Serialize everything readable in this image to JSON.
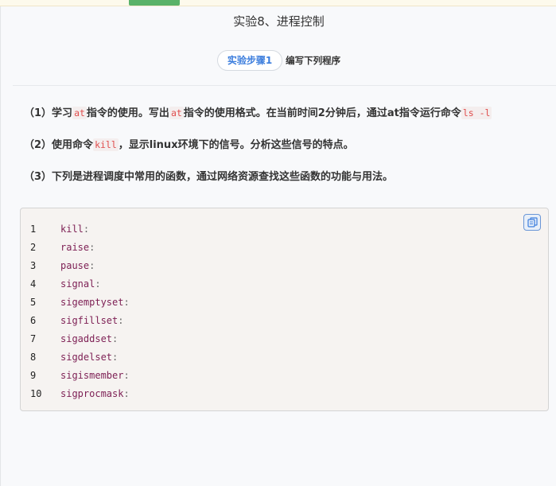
{
  "page": {
    "title": "实验8、进程控制",
    "step_pill": "实验步骤1",
    "step_desc": "编写下列程序"
  },
  "questions": {
    "q1": {
      "num": "（1）",
      "text_a": "学习",
      "code_a": "at",
      "text_b": "指令的使用。写出",
      "code_b": "at",
      "text_c": "指令的使用格式。在当前时间2分钟后，通过at指令运行命令",
      "code_c": "ls -l"
    },
    "q2": {
      "num": "（2）",
      "text_a": "使用命令",
      "code_a": "kill",
      "text_b": "，显示linux环境下的信号。分析这些信号的特点。"
    },
    "q3": {
      "num": "（3）",
      "text": "下列是进程调度中常用的函数，通过网络资源查找这些函数的功能与用法。"
    }
  },
  "code": {
    "copy_icon": "copy-icon",
    "lines": [
      {
        "num": "1",
        "fn": "kill",
        "sep": ":"
      },
      {
        "num": "2",
        "fn": "raise",
        "sep": ":"
      },
      {
        "num": "3",
        "fn": "pause",
        "sep": ":"
      },
      {
        "num": "4",
        "fn": "signal",
        "sep": ":"
      },
      {
        "num": "5",
        "fn": "sigemptyset",
        "sep": ":"
      },
      {
        "num": "6",
        "fn": "sigfillset",
        "sep": ":"
      },
      {
        "num": "7",
        "fn": "sigaddset",
        "sep": ":"
      },
      {
        "num": "8",
        "fn": "sigdelset",
        "sep": ":"
      },
      {
        "num": "9",
        "fn": "sigismember",
        "sep": ":"
      },
      {
        "num": "10",
        "fn": "sigprocmask",
        "sep": ":"
      }
    ]
  },
  "colors": {
    "accent": "#3b7ddd",
    "code_function": "#7d1f54",
    "inline_code": "#e04d4d",
    "top_tab": "#59b269"
  }
}
